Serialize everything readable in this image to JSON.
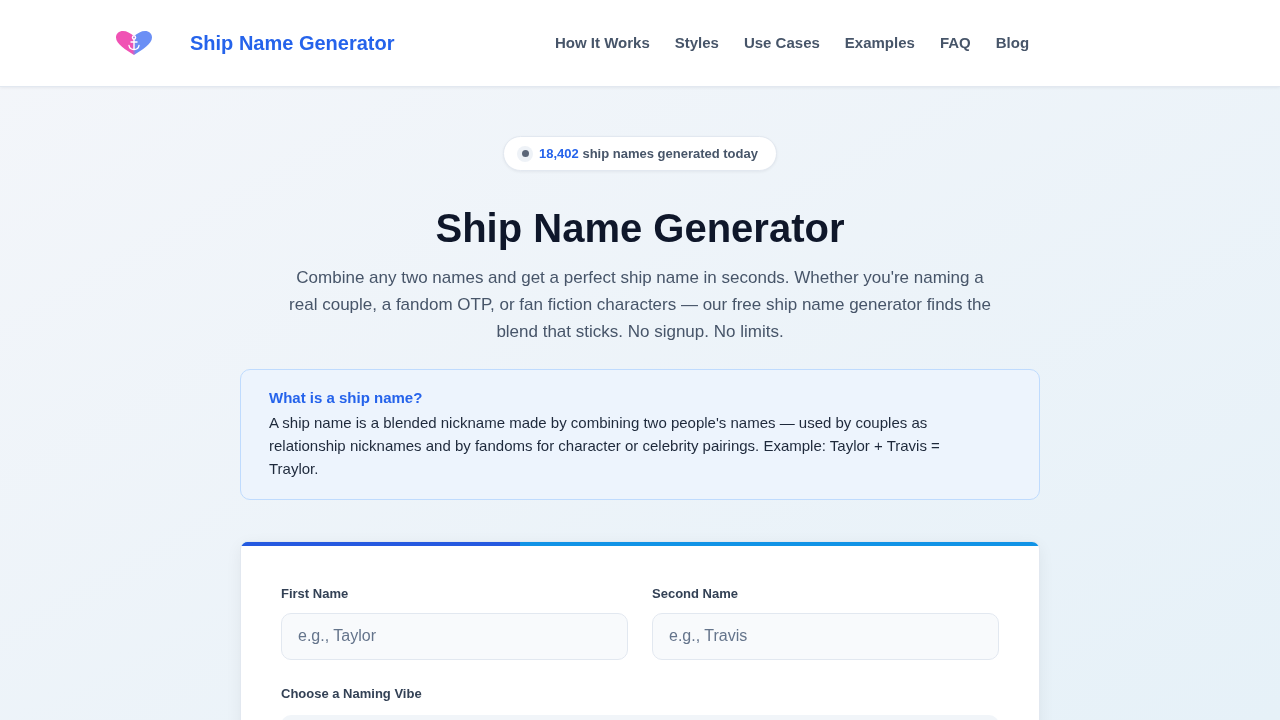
{
  "header": {
    "brand": "Ship Name Generator",
    "nav": [
      "How It Works",
      "Styles",
      "Use Cases",
      "Examples",
      "FAQ",
      "Blog"
    ]
  },
  "badge": {
    "count": "18,402",
    "text": "ship names generated today"
  },
  "hero": {
    "title": "Ship Name Generator",
    "description": "Combine any two names and get a perfect ship name in seconds. Whether you're naming a real couple, a fandom OTP, or fan fiction characters — our free ship name generator finds the blend that sticks. No signup. No limits."
  },
  "info_box": {
    "title": "What is a ship name?",
    "body": "A ship name is a blended nickname made by combining two people's names — used by couples as relationship nicknames and by fandoms for character or celebrity pairings. Example: Taylor + Travis = Traylor."
  },
  "generator": {
    "progress": {
      "level": 0.35
    },
    "fields": [
      {
        "label": "First Name",
        "placeholder": "e.g., Taylor"
      },
      {
        "label": "Second Name",
        "placeholder": "e.g., Travis"
      }
    ],
    "vibe_label": "Choose a Naming Vibe"
  }
}
